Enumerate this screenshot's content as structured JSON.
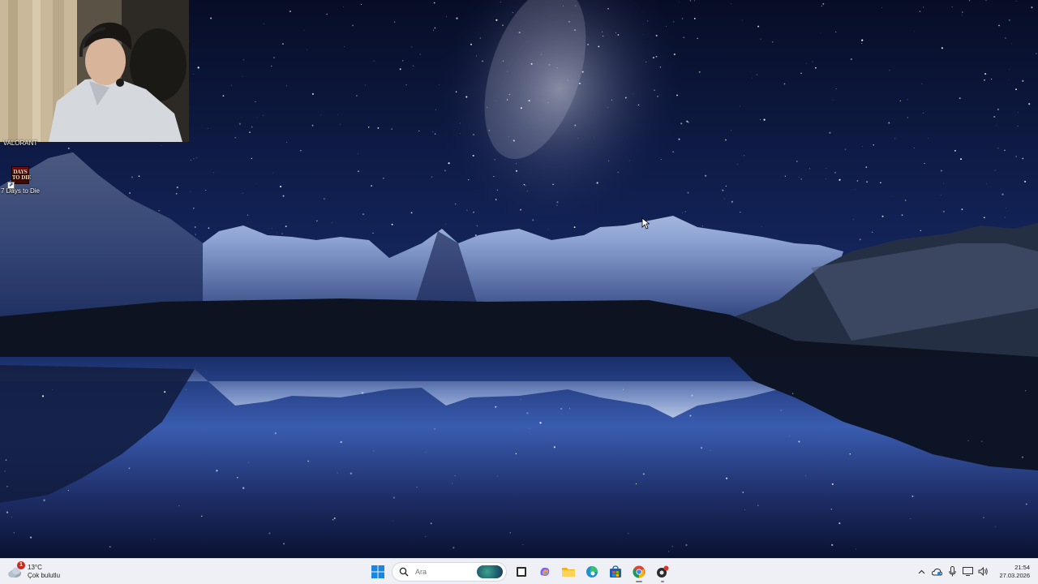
{
  "desktop": {
    "icons": [
      {
        "label": "VALORANT"
      },
      {
        "label": "7 Days to Die",
        "art_text": "DAYS\nTO DIE"
      }
    ]
  },
  "taskbar": {
    "weather": {
      "temperature": "13°C",
      "condition": "Çok bulutlu",
      "badge": "1"
    },
    "search": {
      "placeholder": "Ara"
    },
    "pinned": [
      "start-icon",
      "task-view-icon",
      "copilot-icon",
      "file-explorer-icon",
      "edge-icon",
      "store-icon",
      "chrome-icon",
      "recorder-icon"
    ],
    "tray": {
      "time": "21:54",
      "date": "27.03.2026"
    }
  },
  "colors": {
    "sky_top": "#0a1230",
    "sky_mid": "#1b2f66",
    "taskbar_bg": "#eef0f5",
    "accent": "#0067c0"
  }
}
